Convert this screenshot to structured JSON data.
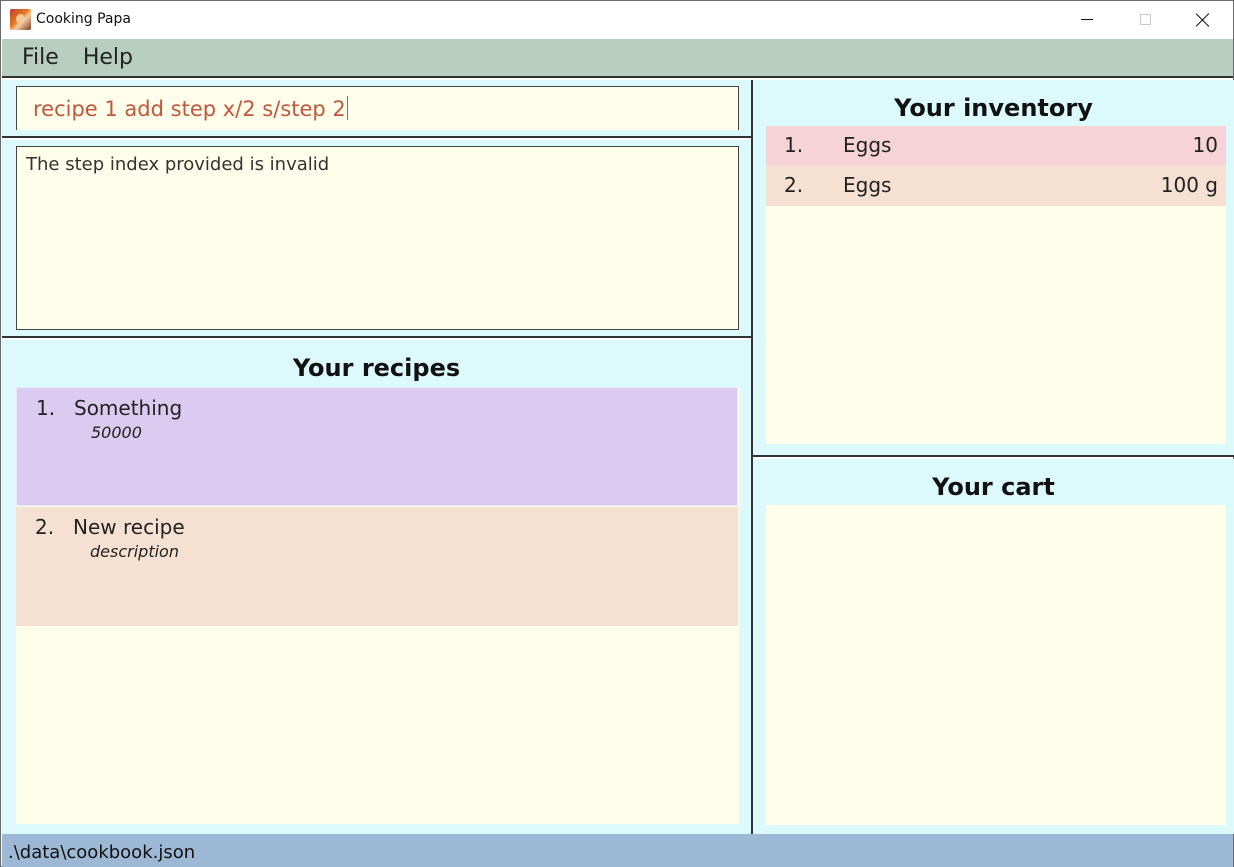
{
  "window": {
    "title": "Cooking Papa",
    "icon": "cooking-papa-app-icon"
  },
  "menu": {
    "items": [
      {
        "label": "File"
      },
      {
        "label": "Help"
      }
    ]
  },
  "command": {
    "value": "recipe 1 add step x/2 s/step 2"
  },
  "result": {
    "message": "The step index provided is invalid"
  },
  "recipes": {
    "title": "Your recipes",
    "items": [
      {
        "index": "1.",
        "name": "Something",
        "description": "50000",
        "color": "#dccbf0"
      },
      {
        "index": "2.",
        "name": "New recipe",
        "description": "description",
        "color": "#f6e0d2"
      }
    ]
  },
  "inventory": {
    "title": "Your inventory",
    "items": [
      {
        "index": "1.",
        "name": "Eggs",
        "quantity": "10",
        "color": "#f5d3d6"
      },
      {
        "index": "2.",
        "name": "Eggs",
        "quantity": "100 g",
        "color": "#f6e0d2"
      }
    ]
  },
  "cart": {
    "title": "Your cart",
    "items": []
  },
  "status": {
    "path": ".\\data\\cookbook.json"
  },
  "colors": {
    "menubar": "#b8cec0",
    "pane_bg": "#dcfafc",
    "list_bg": "#fefeea",
    "statusbar": "#9cb8d4",
    "command_text": "#c0573e"
  }
}
